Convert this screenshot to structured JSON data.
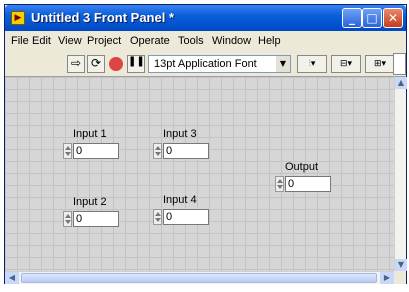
{
  "window": {
    "title": "Untitled 3 Front Panel *",
    "title_icon": "labview-vi-icon",
    "title_icon_glyph": "▶",
    "minimize_glyph": "_",
    "maximize_glyph": "□",
    "close_glyph": "✕"
  },
  "menu": [
    "File",
    "Edit",
    "View",
    "Project",
    "Operate",
    "Tools",
    "Window",
    "Help"
  ],
  "toolbar": {
    "run_icon": "run-arrow-icon",
    "run_glyph": "⇨",
    "run_continuously_glyph": "⟳",
    "pause_glyph": "❚❚",
    "font_label": "13pt Application Font",
    "font_dropdown_glyph": "▼",
    "align_glyph": "⫶▾",
    "distribute_glyph": "⊟▾",
    "resize_glyph": "⊞▾"
  },
  "panel": {
    "background": "#d6d6d6",
    "controls": [
      {
        "label": "Input 1",
        "value": "0"
      },
      {
        "label": "Input 3",
        "value": "0"
      },
      {
        "label": "Input 2",
        "value": "0"
      },
      {
        "label": "Input 4",
        "value": "0"
      }
    ],
    "indicator": {
      "label": "Output",
      "value": "0"
    }
  },
  "scrollbars": {
    "up_glyph": "▲",
    "down_glyph": "▼",
    "left_glyph": "◀",
    "right_glyph": "▶"
  }
}
